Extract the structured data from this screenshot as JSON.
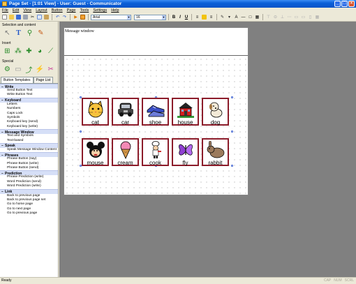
{
  "window": {
    "title": "Page Set - [1:01 View] - User: Guest - Communicator"
  },
  "menu": [
    "File",
    "Edit",
    "View",
    "Layout",
    "Button",
    "Page",
    "Tools",
    "Settings",
    "Help"
  ],
  "toolbar": {
    "font_name": "Arial",
    "font_size": "16",
    "bold": "B",
    "italic": "I",
    "underline": "U"
  },
  "left_panel": {
    "selection_label": "Selection and content",
    "insert_label": "Insert",
    "special_label": "Special",
    "tabs": [
      "Button Templates",
      "Page List"
    ],
    "categories": [
      {
        "name": "Write",
        "items": [
          "Send Button Text",
          "Write Button Text"
        ]
      },
      {
        "name": "Keyboard",
        "items": [
          "Letters",
          "Numbers",
          "Caps Lock",
          "Symbols",
          "Keyboard key (send)",
          "Keyboard key (write)"
        ]
      },
      {
        "name": "Message Window",
        "items": [
          "Text and Symbols",
          "Text-based"
        ]
      },
      {
        "name": "Speak",
        "items": [
          "Speak Message Window Content"
        ]
      },
      {
        "name": "Phrases",
        "items": [
          "Phrase Button (say)",
          "Phrase Button (write)",
          "Phrase Button (send)"
        ]
      },
      {
        "name": "Prediction",
        "items": [
          "Phrase Prediction (write)",
          "Word Prediction (send)",
          "Word Prediction (write)"
        ]
      },
      {
        "name": "Link",
        "items": [
          "Back to previous page",
          "Back to previous page set",
          "Go to home page",
          "Go to next page",
          "Go to previous page"
        ]
      }
    ]
  },
  "page": {
    "message_window": "Message window",
    "buttons": [
      "cat",
      "car",
      "shoe",
      "house",
      "dog",
      "mouse",
      "cream",
      "cook",
      "fly",
      "rabbit"
    ]
  },
  "status": {
    "text": "Ready",
    "keys": [
      "CAP",
      "NUM",
      "SCRL"
    ]
  }
}
